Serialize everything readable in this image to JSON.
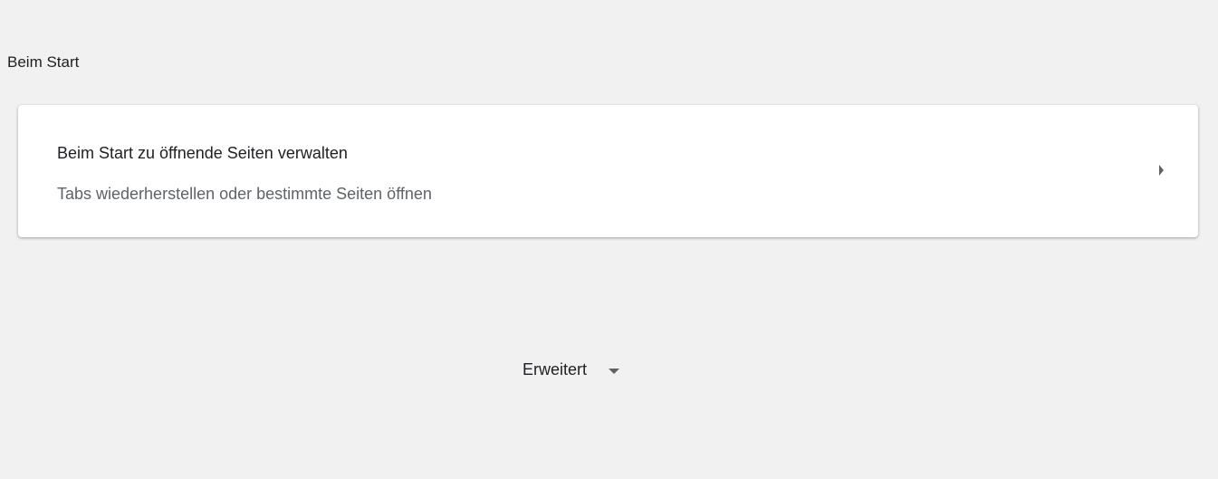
{
  "section": {
    "title": "Beim Start"
  },
  "startup_card": {
    "primary": "Beim Start zu öffnende Seiten verwalten",
    "secondary": "Tabs wiederherstellen oder bestimmte Seiten öffnen",
    "icon": "arrow-right-icon"
  },
  "advanced": {
    "label": "Erweitert",
    "icon": "arrow-down-icon"
  },
  "colors": {
    "background": "#f1f1f1",
    "card": "#ffffff",
    "text_primary": "#202124",
    "text_secondary": "#5f6368"
  }
}
